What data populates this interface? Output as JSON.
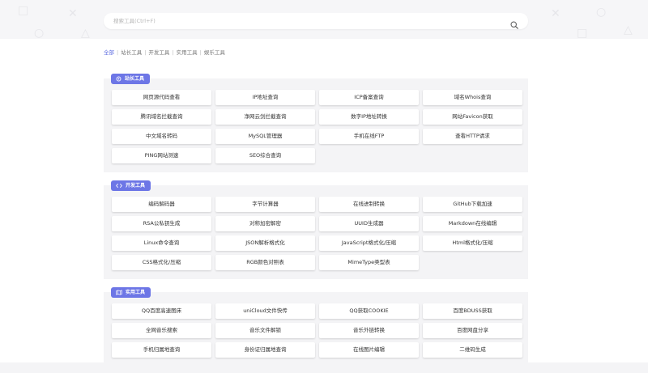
{
  "search": {
    "placeholder": "搜索工具(Ctrl+F)",
    "value": ""
  },
  "breadcrumb": [
    "全部",
    "站长工具",
    "开发工具",
    "实用工具",
    "娱乐工具"
  ],
  "sections": [
    {
      "title": "站长工具",
      "icon": "settings-icon",
      "tools": [
        "网页源代码查看",
        "IP地址查询",
        "ICP备案查询",
        "域名Whois查询",
        "腾讯域名拦截查询",
        "净网云剑拦截查询",
        "数字IP地址转换",
        "网站Favicon获取",
        "中文域名转码",
        "MySQL管理器",
        "手机在线FTP",
        "查看HTTP请求",
        "PING网站测速",
        "SEO综合查询"
      ]
    },
    {
      "title": "开发工具",
      "icon": "code-icon",
      "tools": [
        "编码解码器",
        "字节计算器",
        "在线进制转换",
        "GitHub下载加速",
        "RSA公私钥生成",
        "对称加密解密",
        "UUID生成器",
        "Markdown在线编辑",
        "Linux命令查询",
        "JSON解析格式化",
        "JavaScript格式化/压缩",
        "Html格式化/压缩",
        "CSS格式化/压缩",
        "RGB颜色对照表",
        "MimeType类型表"
      ]
    },
    {
      "title": "实用工具",
      "icon": "map-icon",
      "tools": [
        "QQ百度高速图床",
        "uniCloud文件快传",
        "QQ获取COOKIE",
        "百度BDUSS获取",
        "全网音乐搜索",
        "音乐文件解锁",
        "音乐外链转换",
        "百度网盘分享",
        "手机归属地查询",
        "身份证归属地查询",
        "在线图片编辑",
        "二维码生成"
      ]
    }
  ]
}
